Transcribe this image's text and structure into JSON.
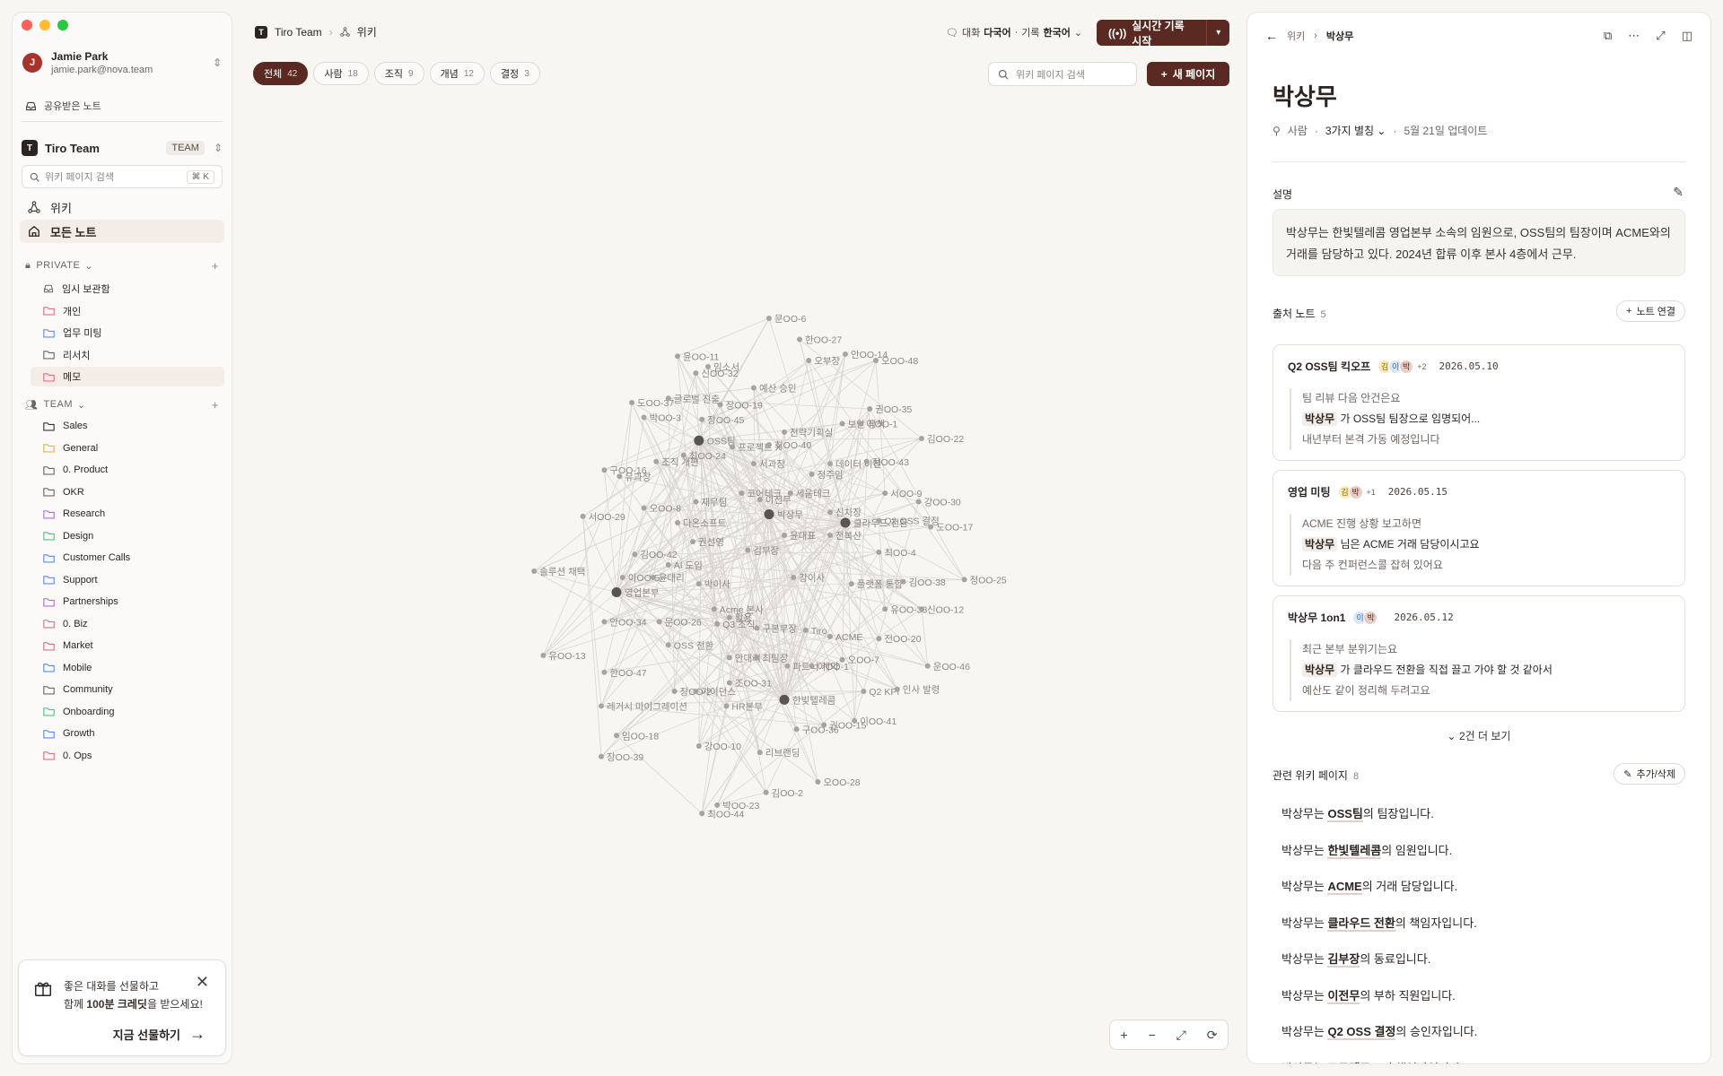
{
  "sidebar": {
    "user": {
      "initial": "J",
      "name": "Jamie Park",
      "email": "jamie.park@nova.team"
    },
    "shared_label": "공유받은 노트",
    "team": {
      "logo": "T",
      "name": "Tiro Team",
      "badge": "TEAM"
    },
    "search_placeholder": "위키 페이지 검색",
    "search_kbd": "⌘ K",
    "nav": [
      {
        "label": "위키",
        "icon": "graph-icon"
      },
      {
        "label": "모든 노트",
        "icon": "home-icon"
      }
    ],
    "private_label": "PRIVATE",
    "private_folders": [
      {
        "label": "임시 보관함",
        "color": "#6f6660",
        "icon": "inbox-icon"
      },
      {
        "label": "개인",
        "color": "#e36d8a"
      },
      {
        "label": "업무 미팅",
        "color": "#5b8def"
      },
      {
        "label": "리서치",
        "color": "#6f6660"
      },
      {
        "label": "메모",
        "color": "#e36d8a"
      }
    ],
    "team_label": "TEAM",
    "team_folders": [
      {
        "label": "Sales",
        "color": "#3a312b"
      },
      {
        "label": "General",
        "color": "#e8b23a"
      },
      {
        "label": "0. Product",
        "color": "#6f6660"
      },
      {
        "label": "OKR",
        "color": "#6f6660"
      },
      {
        "label": "Research",
        "color": "#b06ee0"
      },
      {
        "label": "Design",
        "color": "#4ec48a"
      },
      {
        "label": "Customer Calls",
        "color": "#5b8def"
      },
      {
        "label": "Support",
        "color": "#5b8def"
      },
      {
        "label": "Partnerships",
        "color": "#b06ee0"
      },
      {
        "label": "0. Biz",
        "color": "#e36d8a"
      },
      {
        "label": "Market",
        "color": "#e36d8a"
      },
      {
        "label": "Mobile",
        "color": "#5b8def"
      },
      {
        "label": "Community",
        "color": "#6f6660"
      },
      {
        "label": "Onboarding",
        "color": "#4ec48a"
      },
      {
        "label": "Growth",
        "color": "#5b8def"
      },
      {
        "label": "0. Ops",
        "color": "#e36d8a"
      }
    ],
    "gift": {
      "line1": "좋은 대화를 선물하고",
      "line2_pre": "함께 ",
      "line2_bold": "100분 크레딧",
      "line2_post": "을 받으세요!",
      "cta": "지금 선물하기"
    }
  },
  "header": {
    "team": "Tiro Team",
    "page": "위키",
    "lang_label1": "대화",
    "lang_value1": "다국어",
    "lang_label2": "기록",
    "lang_value2": "한국어",
    "record_label": "실시간 기록 시작"
  },
  "filters": [
    {
      "label": "전체",
      "count": "42"
    },
    {
      "label": "사람",
      "count": "18"
    },
    {
      "label": "조직",
      "count": "9"
    },
    {
      "label": "개념",
      "count": "12"
    },
    {
      "label": "결정",
      "count": "3"
    }
  ],
  "graph_search_placeholder": "위키 페이지 검색",
  "new_page_label": "새 페이지",
  "graph": {
    "nodes": [
      [
        "문OO-6",
        0.0,
        -1.0,
        0
      ],
      [
        "한OO-27",
        0.1,
        -0.9,
        0
      ],
      [
        "안OO-14",
        0.25,
        -0.83,
        0
      ],
      [
        "오OO-48",
        0.35,
        -0.8,
        0
      ],
      [
        "오부장",
        0.13,
        -0.8,
        0
      ],
      [
        "윤OO-11",
        -0.3,
        -0.82,
        0
      ],
      [
        "신OO-32",
        -0.24,
        -0.74,
        0
      ],
      [
        "임소서",
        -0.2,
        -0.77,
        0
      ],
      [
        "예산 승인",
        -0.05,
        -0.67,
        0
      ],
      [
        "도OO-37",
        -0.45,
        -0.6,
        0
      ],
      [
        "글로벌 진출",
        -0.33,
        -0.62,
        0
      ],
      [
        "장OO-19",
        -0.16,
        -0.59,
        0
      ],
      [
        "박OO-3",
        -0.41,
        -0.53,
        0
      ],
      [
        "장OO-45",
        -0.22,
        -0.52,
        0
      ],
      [
        "권OO-35",
        0.33,
        -0.57,
        0
      ],
      [
        "보안 정책",
        0.24,
        -0.5,
        0
      ],
      [
        "이OO-1",
        0.3,
        -0.5,
        0
      ],
      [
        "전략기획실",
        0.05,
        -0.46,
        0
      ],
      [
        "김OO-22",
        0.5,
        -0.43,
        0
      ],
      [
        "OSS팀",
        -0.23,
        -0.42,
        1
      ],
      [
        "프로젝트 X",
        -0.12,
        -0.39,
        0
      ],
      [
        "최OO-40",
        0.0,
        -0.4,
        0
      ],
      [
        "최OO-24",
        -0.28,
        -0.35,
        0
      ],
      [
        "조직 개편",
        -0.37,
        -0.32,
        0
      ],
      [
        "서과장",
        -0.05,
        -0.31,
        0
      ],
      [
        "데이터 이전",
        0.2,
        -0.31,
        0
      ],
      [
        "정OO-43",
        0.32,
        -0.32,
        0
      ],
      [
        "구OO-16",
        -0.54,
        -0.28,
        0
      ],
      [
        "유과장",
        -0.49,
        -0.25,
        0
      ],
      [
        "정주임",
        0.14,
        -0.26,
        0
      ],
      [
        "코어테크",
        -0.09,
        -0.17,
        0
      ],
      [
        "세움테크",
        0.07,
        -0.17,
        0
      ],
      [
        "서OO-9",
        0.38,
        -0.17,
        0
      ],
      [
        "강OO-30",
        0.49,
        -0.13,
        0
      ],
      [
        "재무팀",
        -0.24,
        -0.13,
        0
      ],
      [
        "이전무",
        -0.03,
        -0.14,
        0
      ],
      [
        "박상무",
        0.0,
        -0.07,
        1
      ],
      [
        "신차장",
        0.2,
        -0.08,
        0
      ],
      [
        "오OO-8",
        -0.41,
        -0.1,
        0
      ],
      [
        "서OO-29",
        -0.61,
        -0.06,
        0
      ],
      [
        "다온소프트",
        -0.3,
        -0.03,
        0
      ],
      [
        "클라우드 전환",
        0.25,
        -0.03,
        1
      ],
      [
        "Q2 OSS 결정",
        0.36,
        -0.04,
        0
      ],
      [
        "도OO-17",
        0.53,
        -0.01,
        0
      ],
      [
        "전복산",
        0.2,
        0.03,
        0
      ],
      [
        "윤대표",
        0.05,
        0.03,
        0
      ],
      [
        "권선영",
        -0.25,
        0.06,
        0
      ],
      [
        "김부장",
        -0.07,
        0.1,
        0
      ],
      [
        "김OO-42",
        -0.44,
        0.12,
        0
      ],
      [
        "AI 도입",
        -0.33,
        0.17,
        0
      ],
      [
        "최OO-4",
        0.36,
        0.11,
        0
      ],
      [
        "솔루션 채택",
        -0.77,
        0.2,
        0
      ],
      [
        "이OO-5",
        -0.48,
        0.23,
        0
      ],
      [
        "윤대리",
        -0.38,
        0.23,
        0
      ],
      [
        "강이사",
        0.08,
        0.23,
        0
      ],
      [
        "플랫폼 통합",
        0.27,
        0.26,
        0
      ],
      [
        "김OO-38",
        0.44,
        0.25,
        0
      ],
      [
        "정OO-25",
        0.64,
        0.24,
        0
      ],
      [
        "영업본부",
        -0.5,
        0.3,
        1
      ],
      [
        "박이사",
        -0.23,
        0.26,
        0
      ],
      [
        "Acme 본사",
        -0.18,
        0.38,
        0
      ],
      [
        "유OO-33",
        0.38,
        0.38,
        0
      ],
      [
        "신OO-12",
        0.5,
        0.38,
        0
      ],
      [
        "활용",
        -0.13,
        0.42,
        0
      ],
      [
        "안OO-34",
        -0.54,
        0.44,
        0
      ],
      [
        "문OO-26",
        -0.36,
        0.44,
        0
      ],
      [
        "Q3 조직",
        -0.17,
        0.45,
        0
      ],
      [
        "구본부장",
        -0.04,
        0.47,
        0
      ],
      [
        "Tiro",
        0.12,
        0.48,
        0
      ],
      [
        "ACME",
        0.2,
        0.51,
        0
      ],
      [
        "전OO-20",
        0.36,
        0.52,
        0
      ],
      [
        "OSS 전환",
        -0.33,
        0.55,
        0
      ],
      [
        "유OO-13",
        -0.74,
        0.6,
        0
      ],
      [
        "안대리",
        -0.13,
        0.61,
        0
      ],
      [
        "최팀장",
        -0.04,
        0.61,
        0
      ],
      [
        "오OO-7",
        0.24,
        0.62,
        0
      ],
      [
        "파트너 계약",
        0.06,
        0.65,
        0
      ],
      [
        "어OO-1",
        0.14,
        0.65,
        0
      ],
      [
        "운OO-46",
        0.52,
        0.65,
        0
      ],
      [
        "한OO-47",
        -0.54,
        0.68,
        0
      ],
      [
        "조OO-31",
        -0.13,
        0.73,
        0
      ],
      [
        "장OO-2",
        -0.31,
        0.77,
        0
      ],
      [
        "가이던스",
        -0.24,
        0.77,
        0
      ],
      [
        "Q2 KPI",
        0.31,
        0.77,
        0
      ],
      [
        "인사 발령",
        0.42,
        0.76,
        0
      ],
      [
        "한빛텔레콤",
        0.05,
        0.81,
        1
      ],
      [
        "레거시 마이그레이션",
        -0.55,
        0.84,
        0
      ],
      [
        "HR본부",
        -0.14,
        0.84,
        0
      ],
      [
        "이OO-41",
        0.28,
        0.91,
        0
      ],
      [
        "구OO-36",
        0.09,
        0.95,
        0
      ],
      [
        "권OO-15",
        0.18,
        0.93,
        0
      ],
      [
        "임OO-18",
        -0.5,
        0.98,
        0
      ],
      [
        "강OO-10",
        -0.23,
        1.03,
        0
      ],
      [
        "리브랜딩",
        -0.03,
        1.06,
        0
      ],
      [
        "장OO-39",
        -0.55,
        1.08,
        0
      ],
      [
        "오OO-28",
        0.16,
        1.2,
        0
      ],
      [
        "김OO-2",
        -0.01,
        1.25,
        0
      ],
      [
        "박OO-23",
        -0.17,
        1.31,
        0
      ],
      [
        "최OO-44",
        -0.22,
        1.35,
        0
      ]
    ]
  },
  "panel": {
    "crumb_parent": "위키",
    "crumb_current": "박상무",
    "title": "박상무",
    "type": "사람",
    "aliases": "3가지 별칭",
    "updated": "5월 21일 업데이트",
    "desc_label": "설명",
    "description": "박상무는 한빛텔레콤 영업본부 소속의 임원으로, OSS팀의 팀장이며 ACME와의 거래를 담당하고 있다. 2024년 합류 이후 본사 4층에서 근무.",
    "notes_label": "출처 노트",
    "notes_count": "5",
    "link_note": "노트 연결",
    "notes": [
      {
        "title": "Q2 OSS팀 킥오프",
        "avatars": [
          "김",
          "이",
          "박"
        ],
        "extra": "+2",
        "date": "2026.05.10",
        "q1": "팀 리뷰 다음 안건은요",
        "q2_bold": "박상무",
        "q2": " 가 OSS팀 팀장으로 임명되어...",
        "q3": "내년부터 본격 가동 예정입니다"
      },
      {
        "title": "영업 미팅",
        "avatars": [
          "김",
          "박"
        ],
        "extra": "+1",
        "date": "2026.05.15",
        "q1": "ACME 진행 상황 보고하면",
        "q2_bold": "박상무",
        "q2": " 님은 ACME 거래 담당이시고요",
        "q3": "다음 주 컨퍼런스콜 잡혀 있어요"
      },
      {
        "title": "박상무 1on1",
        "avatars": [
          "이",
          "박"
        ],
        "extra": "",
        "date": "2026.05.12",
        "q1": "최근 본부 분위기는요",
        "q2_bold": "박상무",
        "q2": " 가 클라우드 전환을 직접 끌고 가야 할 것 같아서",
        "q3": "예산도 같이 정리해 두려고요"
      }
    ],
    "show_more": "2건 더 보기",
    "related_label": "관련 위키 페이지",
    "related_count": "8",
    "edit_related": "추가/삭제",
    "related": [
      {
        "pre": "박상무는 ",
        "link": "OSS팀",
        "post": "의 팀장입니다."
      },
      {
        "pre": "박상무는 ",
        "link": "한빛텔레콤",
        "post": "의 임원입니다."
      },
      {
        "pre": "박상무는 ",
        "link": "ACME",
        "post": "의 거래 담당입니다."
      },
      {
        "pre": "박상무는 ",
        "link": "클라우드 전환",
        "post": "의 책임자입니다."
      },
      {
        "pre": "박상무는 ",
        "link": "김부장",
        "post": "의 동료입니다."
      },
      {
        "pre": "박상무는 ",
        "link": "이전무",
        "post": "의 부하 직원입니다."
      },
      {
        "pre": "박상무는 ",
        "link": "Q2 OSS 결정",
        "post": "의 승인자입니다."
      },
      {
        "pre": "박상무는 ",
        "link": "프로젝트 X",
        "post": "의 책임자입니다."
      }
    ]
  }
}
